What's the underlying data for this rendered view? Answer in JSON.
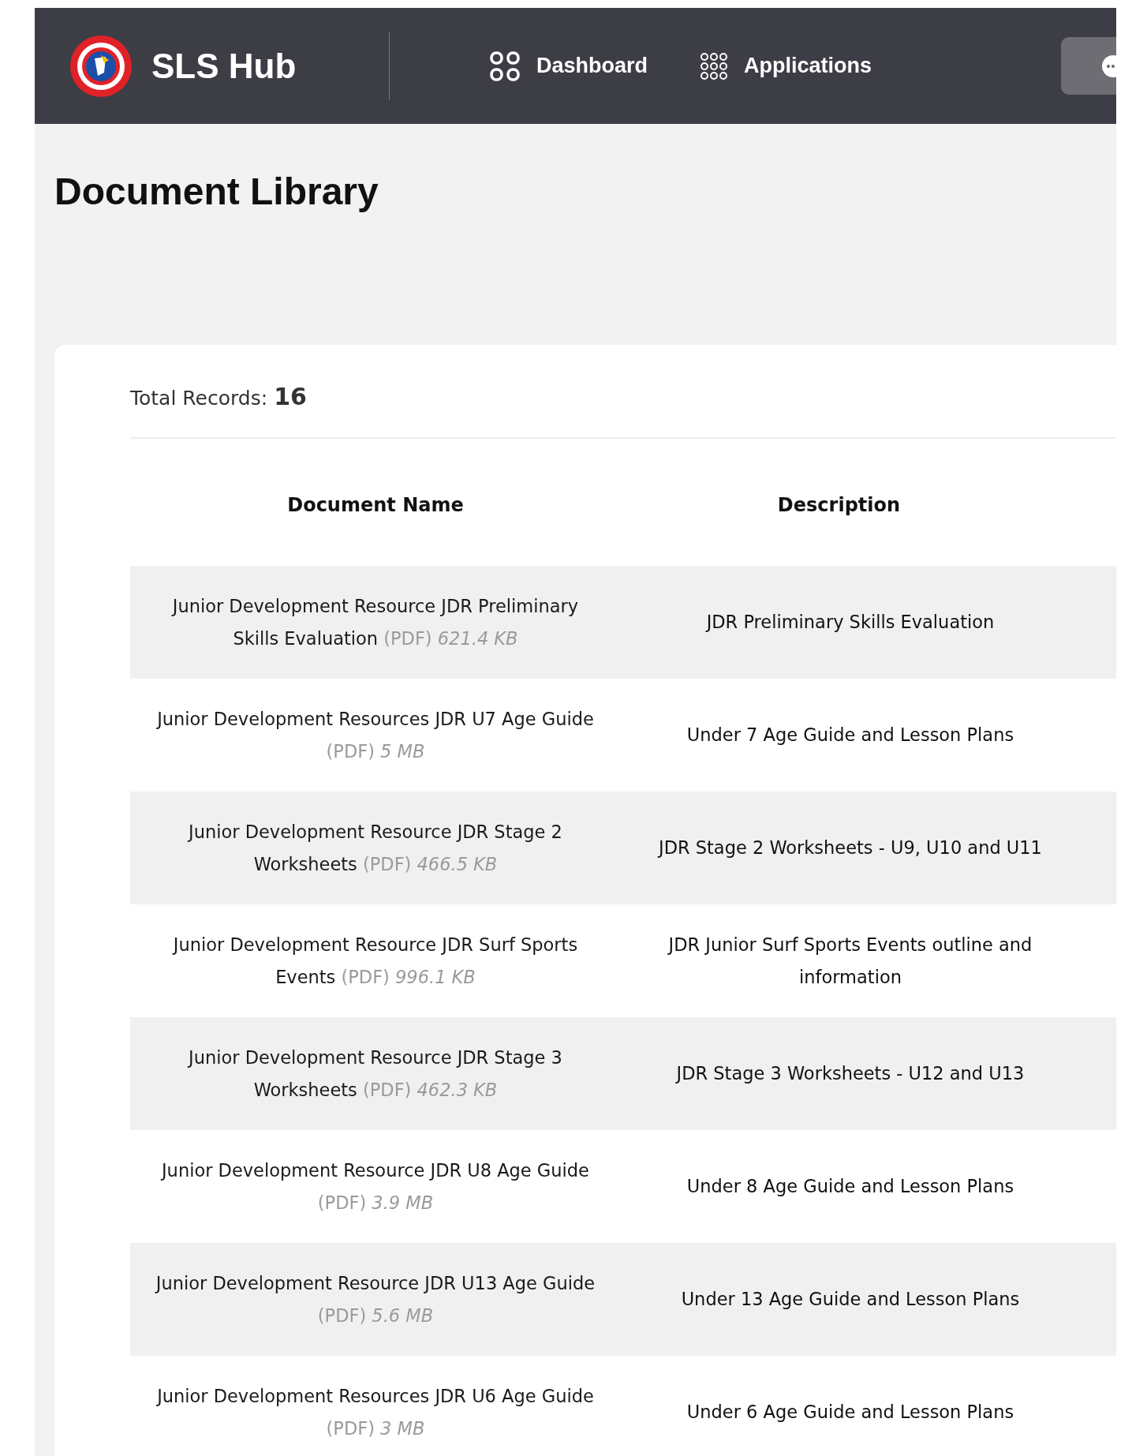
{
  "header": {
    "brand": "SLS Hub",
    "nav": [
      {
        "label": "Dashboard",
        "kind": "dashboard"
      },
      {
        "label": "Applications",
        "kind": "applications"
      }
    ]
  },
  "page_title": "Document Library",
  "total_records": {
    "label": "Total Records:",
    "value": "16"
  },
  "table": {
    "columns": [
      "Document Name",
      "Description"
    ],
    "rows": [
      {
        "name": "Junior Development Resource JDR Preliminary Skills Evaluation",
        "type": "(PDF)",
        "size": "621.4 KB",
        "description": "JDR Preliminary Skills Evaluation"
      },
      {
        "name": "Junior Development Resources JDR U7 Age Guide",
        "type": "(PDF)",
        "size": "5 MB",
        "description": "Under 7 Age Guide and Lesson Plans"
      },
      {
        "name": "Junior Development Resource JDR Stage 2 Worksheets",
        "type": "(PDF)",
        "size": "466.5 KB",
        "description": "JDR Stage 2 Worksheets - U9, U10 and U11"
      },
      {
        "name": "Junior Development Resource JDR Surf Sports Events",
        "type": "(PDF)",
        "size": "996.1 KB",
        "description": "JDR Junior Surf Sports Events outline and information"
      },
      {
        "name": "Junior Development Resource JDR Stage 3 Worksheets",
        "type": "(PDF)",
        "size": "462.3 KB",
        "description": "JDR Stage 3 Worksheets - U12 and U13"
      },
      {
        "name": "Junior Development Resource JDR U8 Age Guide",
        "type": "(PDF)",
        "size": "3.9 MB",
        "description": "Under 8 Age Guide and Lesson Plans"
      },
      {
        "name": "Junior Development Resource JDR U13 Age Guide",
        "type": "(PDF)",
        "size": "5.6 MB",
        "description": "Under 13 Age Guide and Lesson Plans"
      },
      {
        "name": "Junior Development Resources JDR U6 Age Guide",
        "type": "(PDF)",
        "size": "3 MB",
        "description": "Under 6 Age Guide and Lesson Plans"
      }
    ]
  }
}
